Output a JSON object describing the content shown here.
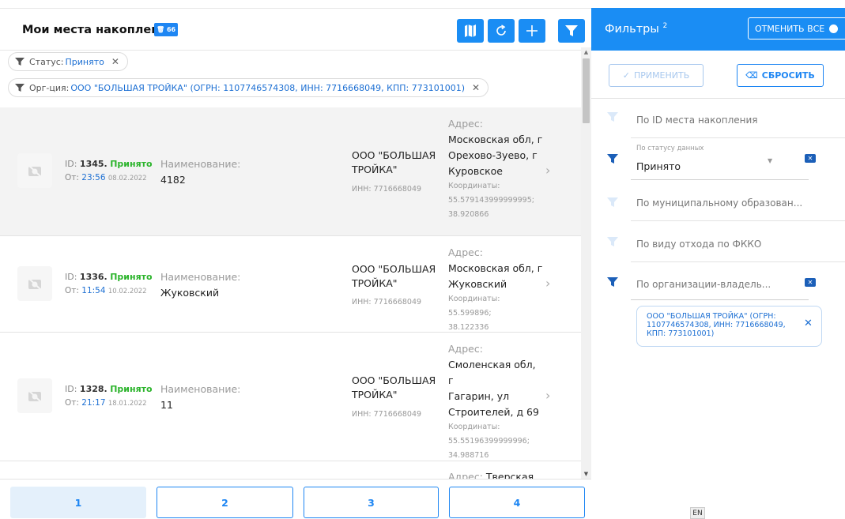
{
  "header": {
    "title": "Мои места накопления",
    "badge": "66",
    "buttons": [
      "map-icon",
      "refresh-icon",
      "add-icon",
      "filter-icon"
    ]
  },
  "chips": [
    {
      "label": "Статус:",
      "value": "Принято"
    },
    {
      "label": "Орг-ция:",
      "value": "ООО \"БОЛЬШАЯ ТРОЙКА\" (ОГРН: 1107746574308, ИНН: 7716668049, КПП: 773101001)"
    }
  ],
  "rows": [
    {
      "id_label": "ID:",
      "id": "1345.",
      "status": "Принято",
      "from_label": "От:",
      "time": "23:56",
      "date": "08.02.2022",
      "name_label": "Наименование:",
      "name": "4182",
      "org_line1": "ООО \"БОЛЬШАЯ",
      "org_line2": "ТРОЙКА\"",
      "inn": "ИНН: 7716668049",
      "addr_label": "Адрес:",
      "addr_lines": [
        "Московская обл, г",
        "Орехово-Зуево, г",
        "Куровское"
      ],
      "coord_lines": [
        "Координаты:",
        "55.579143999999995;",
        "38.920866"
      ]
    },
    {
      "id_label": "ID:",
      "id": "1336.",
      "status": "Принято",
      "from_label": "От:",
      "time": "11:54",
      "date": "10.02.2022",
      "name_label": "Наименование:",
      "name": "Жуковский",
      "org_line1": "ООО \"БОЛЬШАЯ",
      "org_line2": "ТРОЙКА\"",
      "inn": "ИНН: 7716668049",
      "addr_label": "Адрес:",
      "addr_lines": [
        "Московская обл, г",
        "Жуковский"
      ],
      "coord_lines": [
        "Координаты: 55.599896;",
        "38.122336"
      ]
    },
    {
      "id_label": "ID:",
      "id": "1328.",
      "status": "Принято",
      "from_label": "От:",
      "time": "21:17",
      "date": "18.01.2022",
      "name_label": "Наименование:",
      "name": "11",
      "org_line1": "ООО \"БОЛЬШАЯ",
      "org_line2": "ТРОЙКА\"",
      "inn": "ИНН: 7716668049",
      "addr_label": "Адрес:",
      "addr_lines": [
        "Смоленская обл, г",
        "Гагарин, ул",
        "Строителей, д 69"
      ],
      "coord_lines": [
        "Координаты:",
        "55.55196399999996;",
        "34.988716"
      ]
    },
    {
      "addr_label": "Адрес:",
      "addr_partial": "Тверская"
    }
  ],
  "pagination": [
    "1",
    "2",
    "3",
    "4"
  ],
  "filters_panel": {
    "title": "Фильтры",
    "count": "2",
    "cancel_all": "ОТМЕНИТЬ ВСЕ",
    "apply": "ПРИМЕНИТЬ",
    "reset": "СБРОСИТЬ",
    "filters": [
      {
        "label": "По ID места накопления"
      },
      {
        "small_label": "По статусу данных",
        "value": "Принято"
      },
      {
        "label": "По муниципальному образован..."
      },
      {
        "label": "По виду отхода по ФККО"
      },
      {
        "label": "По организации-владель..."
      }
    ],
    "org_tag": "ООО \"БОЛЬШАЯ ТРОЙКА\" (ОГРН: 1107746574308, ИНН: 7716668049, КПП: 773101001)"
  },
  "lang": "EN",
  "colors": {
    "accent": "#1a8df4",
    "status_ok": "#2cb42c",
    "link": "#1c6fd3"
  }
}
